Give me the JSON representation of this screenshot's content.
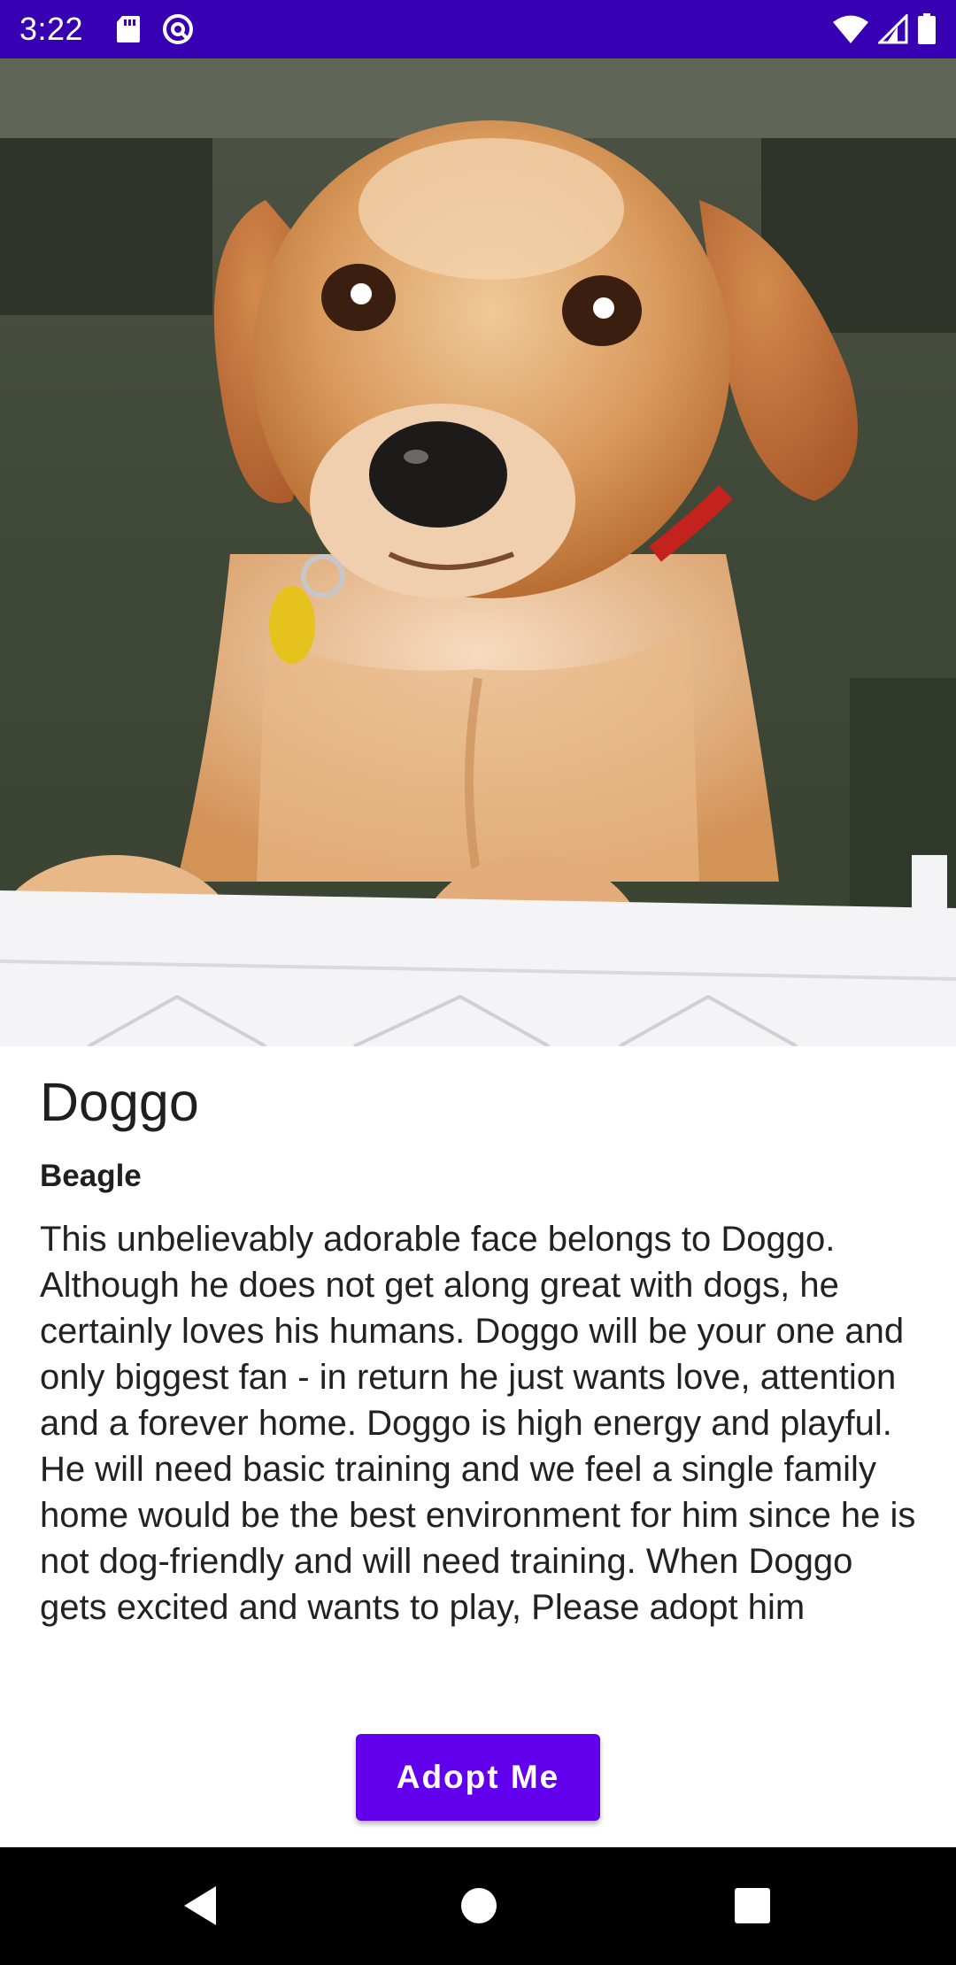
{
  "status_bar": {
    "time": "3:22",
    "icons": [
      "sd-card-icon",
      "sync-icon",
      "wifi-icon",
      "signal-icon",
      "battery-icon"
    ]
  },
  "hero": {
    "alt_icon": "dog-photo"
  },
  "pet": {
    "name": "Doggo",
    "breed": "Beagle",
    "description": "This unbelievably adorable face belongs to Doggo. Although he does not get along great with dogs, he certainly loves his humans. Doggo will be your one and only biggest fan - in return he just wants love, attention and a forever home. Doggo is high energy and playful. He will need basic training and we feel a single family home would be the best environment for him since he is not dog-friendly and will need training. When Doggo gets excited and wants to play, Please adopt him"
  },
  "actions": {
    "adopt_label": "Adopt Me"
  },
  "nav_bar": {
    "buttons": [
      "back-icon",
      "home-icon",
      "recents-icon"
    ]
  },
  "colors": {
    "status_bar": "#3700b3",
    "accent": "#6200ee",
    "nav_bar": "#000000"
  }
}
